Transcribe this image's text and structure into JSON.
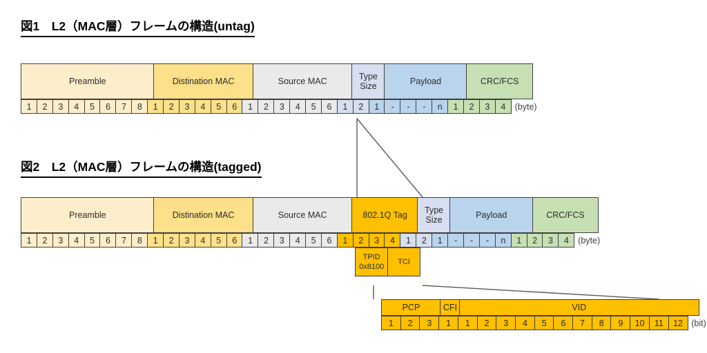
{
  "figures": [
    {
      "title": "図1　L2（MAC層）フレームの構造(untag)",
      "unit": "(byte)",
      "blocks": [
        {
          "label": "Preamble",
          "color": "#FDEECB",
          "cells": [
            "1",
            "2",
            "3",
            "4",
            "5",
            "6",
            "7",
            "8"
          ]
        },
        {
          "label": "Distination MAC",
          "color": "#FCE08A",
          "cells": [
            "1",
            "2",
            "3",
            "4",
            "5",
            "6"
          ]
        },
        {
          "label": "Source MAC",
          "color": "#EAEAEA",
          "cells": [
            "1",
            "2",
            "3",
            "4",
            "5",
            "6"
          ]
        },
        {
          "label": "Type\nSize",
          "color": "#D7DEF0",
          "cells": [
            "1",
            "2"
          ]
        },
        {
          "label": "Payload",
          "color": "#BAD4EE",
          "cells": [
            "1",
            "-",
            "-",
            "-",
            "n"
          ]
        },
        {
          "label": "CRC/FCS",
          "color": "#C6E0B4",
          "cells": [
            "1",
            "2",
            "3",
            "4"
          ]
        }
      ]
    },
    {
      "title": "図2　L2（MAC層）フレームの構造(tagged)",
      "unit": "(byte)",
      "blocks": [
        {
          "label": "Preamble",
          "color": "#FDEECB",
          "cells": [
            "1",
            "2",
            "3",
            "4",
            "5",
            "6",
            "7",
            "8"
          ]
        },
        {
          "label": "Distination MAC",
          "color": "#FCE08A",
          "cells": [
            "1",
            "2",
            "3",
            "4",
            "5",
            "6"
          ]
        },
        {
          "label": "Source MAC",
          "color": "#EAEAEA",
          "cells": [
            "1",
            "2",
            "3",
            "4",
            "5",
            "6"
          ]
        },
        {
          "label": "802.1Q Tag",
          "color": "#FFC000",
          "cells": [
            "1",
            "2",
            "3",
            "4"
          ]
        },
        {
          "label": "Type\nSize",
          "color": "#D7DEF0",
          "cells": [
            "1",
            "2"
          ]
        },
        {
          "label": "Payload",
          "color": "#BAD4EE",
          "cells": [
            "1",
            "-",
            "-",
            "-",
            "n"
          ]
        },
        {
          "label": "CRC/FCS",
          "color": "#C6E0B4",
          "cells": [
            "1",
            "2",
            "3",
            "4"
          ]
        }
      ],
      "subfields": [
        {
          "label": "TPID",
          "sublabel": "0x8100",
          "color": "#FFC000",
          "span": 2
        },
        {
          "label": "TCI",
          "sublabel": "",
          "color": "#FFC000",
          "span": 2
        }
      ]
    }
  ],
  "tci_detail": {
    "unit": "(bit)",
    "blocks": [
      {
        "label": "PCP",
        "color": "#FFC000",
        "cells": [
          "1",
          "2",
          "3"
        ]
      },
      {
        "label": "CFI",
        "color": "#FFC000",
        "cells": [
          "1"
        ]
      },
      {
        "label": "VID",
        "color": "#FFC000",
        "cells": [
          "1",
          "2",
          "3",
          "4",
          "5",
          "6",
          "7",
          "8",
          "9",
          "10",
          "11",
          "12"
        ]
      }
    ]
  }
}
